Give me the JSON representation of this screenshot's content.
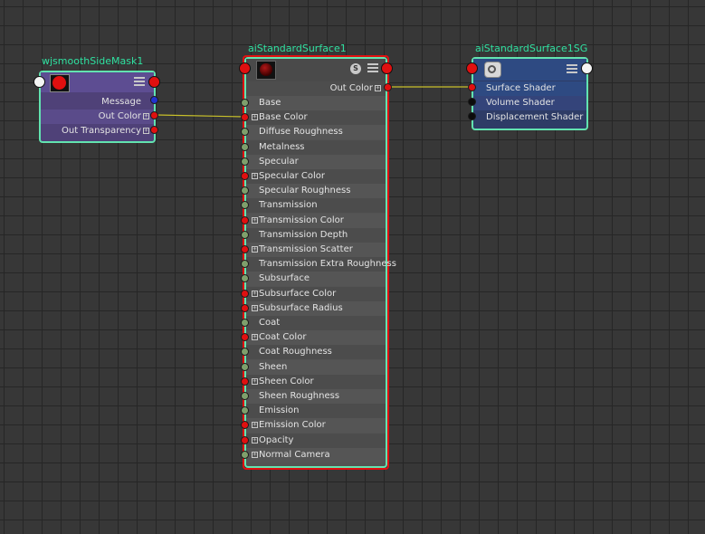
{
  "nodes": {
    "mask": {
      "title": "wjsmoothSideMask1",
      "attrs": [
        "Message",
        "Out Color",
        "Out Transparency"
      ]
    },
    "surface": {
      "title": "aiStandardSurface1",
      "badge": "S",
      "out_label": "Out Color",
      "attrs": [
        {
          "label": "Base",
          "port": "green",
          "expand": false
        },
        {
          "label": "Base Color",
          "port": "red",
          "expand": true
        },
        {
          "label": "Diffuse Roughness",
          "port": "green",
          "expand": false
        },
        {
          "label": "Metalness",
          "port": "green",
          "expand": false
        },
        {
          "label": "Specular",
          "port": "green",
          "expand": false
        },
        {
          "label": "Specular Color",
          "port": "red",
          "expand": true
        },
        {
          "label": "Specular Roughness",
          "port": "green",
          "expand": false
        },
        {
          "label": "Transmission",
          "port": "green",
          "expand": false
        },
        {
          "label": "Transmission Color",
          "port": "red",
          "expand": true
        },
        {
          "label": "Transmission Depth",
          "port": "green",
          "expand": false
        },
        {
          "label": "Transmission Scatter",
          "port": "red",
          "expand": true
        },
        {
          "label": "Transmission Extra Roughness",
          "port": "green",
          "expand": false
        },
        {
          "label": "Subsurface",
          "port": "green",
          "expand": false
        },
        {
          "label": "Subsurface Color",
          "port": "red",
          "expand": true
        },
        {
          "label": "Subsurface Radius",
          "port": "red",
          "expand": true
        },
        {
          "label": "Coat",
          "port": "green",
          "expand": false
        },
        {
          "label": "Coat Color",
          "port": "red",
          "expand": true
        },
        {
          "label": "Coat Roughness",
          "port": "green",
          "expand": false
        },
        {
          "label": "Sheen",
          "port": "green",
          "expand": false
        },
        {
          "label": "Sheen Color",
          "port": "red",
          "expand": true
        },
        {
          "label": "Sheen Roughness",
          "port": "green",
          "expand": false
        },
        {
          "label": "Emission",
          "port": "green",
          "expand": false
        },
        {
          "label": "Emission Color",
          "port": "red",
          "expand": true
        },
        {
          "label": "Opacity",
          "port": "red",
          "expand": true
        },
        {
          "label": "Normal Camera",
          "port": "green",
          "expand": true
        }
      ]
    },
    "sg": {
      "title": "aiStandardSurface1SG",
      "attrs": [
        "Surface Shader",
        "Volume Shader",
        "Displacement Shader"
      ]
    }
  },
  "colors": {
    "title": "#2fe0a0",
    "selected_border": "#62e3b0",
    "active_border": "#e01010",
    "wire": "#c8c02a",
    "mask_header": "#5a4a8a",
    "sg_header": "#2e4a82"
  },
  "icons": {
    "mask_swatch": "red-circle-swatch-icon",
    "surface_swatch": "dark-red-sphere-swatch-icon",
    "sg_icon": "shading-group-icon",
    "menu": "attribute-list-icon"
  }
}
